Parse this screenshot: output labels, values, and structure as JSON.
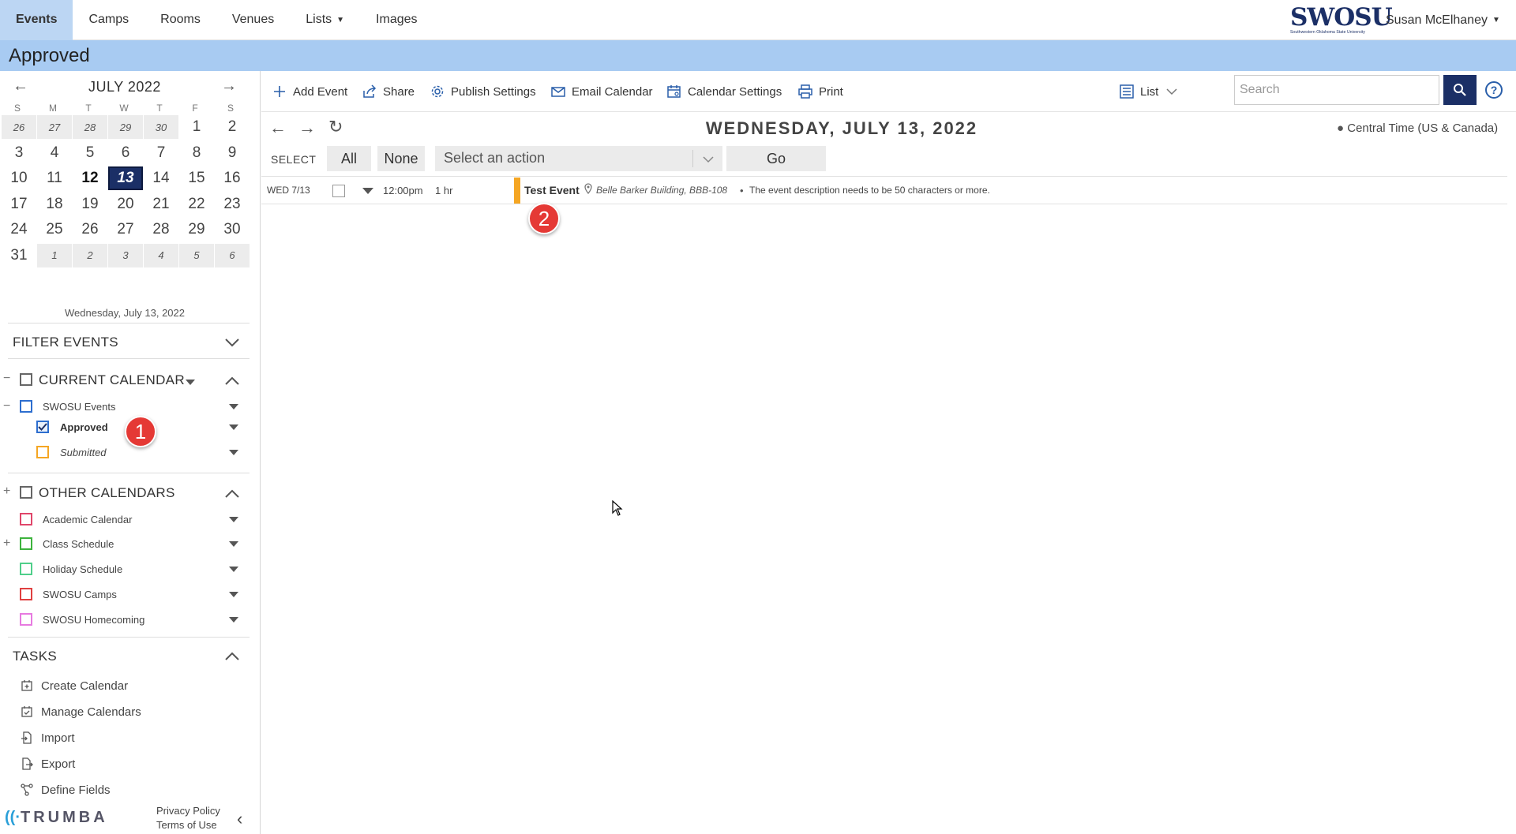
{
  "topnav": {
    "tabs": [
      {
        "label": "Events",
        "active": true
      },
      {
        "label": "Camps"
      },
      {
        "label": "Rooms"
      },
      {
        "label": "Venues"
      },
      {
        "label": "Lists",
        "has_dropdown": true
      },
      {
        "label": "Images"
      }
    ],
    "logo_text": "SWOSU",
    "logo_subtext": "Southwestern Oklahoma State University",
    "user_name": "Susan McElhaney"
  },
  "page_title": "Approved",
  "mini_calendar": {
    "month_label": "JULY 2022",
    "weekdays": [
      "S",
      "M",
      "T",
      "W",
      "T",
      "F",
      "S"
    ],
    "weeks": [
      [
        "26",
        "27",
        "28",
        "29",
        "30",
        "1",
        "2"
      ],
      [
        "3",
        "4",
        "5",
        "6",
        "7",
        "8",
        "9"
      ],
      [
        "10",
        "11",
        "12",
        "13",
        "14",
        "15",
        "16"
      ],
      [
        "17",
        "18",
        "19",
        "20",
        "21",
        "22",
        "23"
      ],
      [
        "24",
        "25",
        "26",
        "27",
        "28",
        "29",
        "30"
      ],
      [
        "31",
        "1",
        "2",
        "3",
        "4",
        "5",
        "6"
      ]
    ],
    "today": "12",
    "selected": "13",
    "selected_date_text": "Wednesday, July 13, 2022"
  },
  "filter": {
    "heading": "FILTER EVENTS",
    "current_calendar": {
      "heading": "CURRENT CALENDAR",
      "items": [
        {
          "label": "SWOSU Events",
          "color": "#2d6ecf",
          "checked": false
        },
        {
          "label": "Approved",
          "color": "#2d6ecf",
          "checked": true
        },
        {
          "label": "Submitted",
          "color": "#f5a623",
          "checked": false
        }
      ]
    },
    "other_calendars": {
      "heading": "OTHER CALENDARS",
      "items": [
        {
          "label": "Academic Calendar",
          "color": "#e0466a"
        },
        {
          "label": "Class Schedule",
          "color": "#3db33d"
        },
        {
          "label": "Holiday Schedule",
          "color": "#4fcf8a"
        },
        {
          "label": "SWOSU Camps",
          "color": "#e04040"
        },
        {
          "label": "SWOSU Homecoming",
          "color": "#e77ae0"
        }
      ]
    }
  },
  "tasks": {
    "heading": "TASKS",
    "items": [
      "Create Calendar",
      "Manage Calendars",
      "Import",
      "Export",
      "Define Fields"
    ]
  },
  "footer": {
    "brand": "TRUMBA",
    "privacy": "Privacy Policy",
    "terms": "Terms of Use"
  },
  "toolbar": {
    "add_event": "Add Event",
    "share": "Share",
    "publish_settings": "Publish Settings",
    "email_calendar": "Email Calendar",
    "calendar_settings": "Calendar Settings",
    "print": "Print",
    "view": "List",
    "search_placeholder": "Search"
  },
  "date_title": "WEDNESDAY, JULY 13, 2022",
  "timezone": "Central Time (US & Canada)",
  "select_bar": {
    "label": "SELECT",
    "all": "All",
    "none": "None",
    "action_placeholder": "Select an action",
    "go": "Go"
  },
  "events": [
    {
      "date": "WED 7/13",
      "time": "12:00pm",
      "duration": "1 hr",
      "title": "Test Event",
      "location": "Belle Barker Building, BBB-108",
      "description": "The event description needs to be 50 characters or more.",
      "color": "#f5a623"
    }
  ],
  "annotations": {
    "badge1": "1",
    "badge2": "2"
  }
}
